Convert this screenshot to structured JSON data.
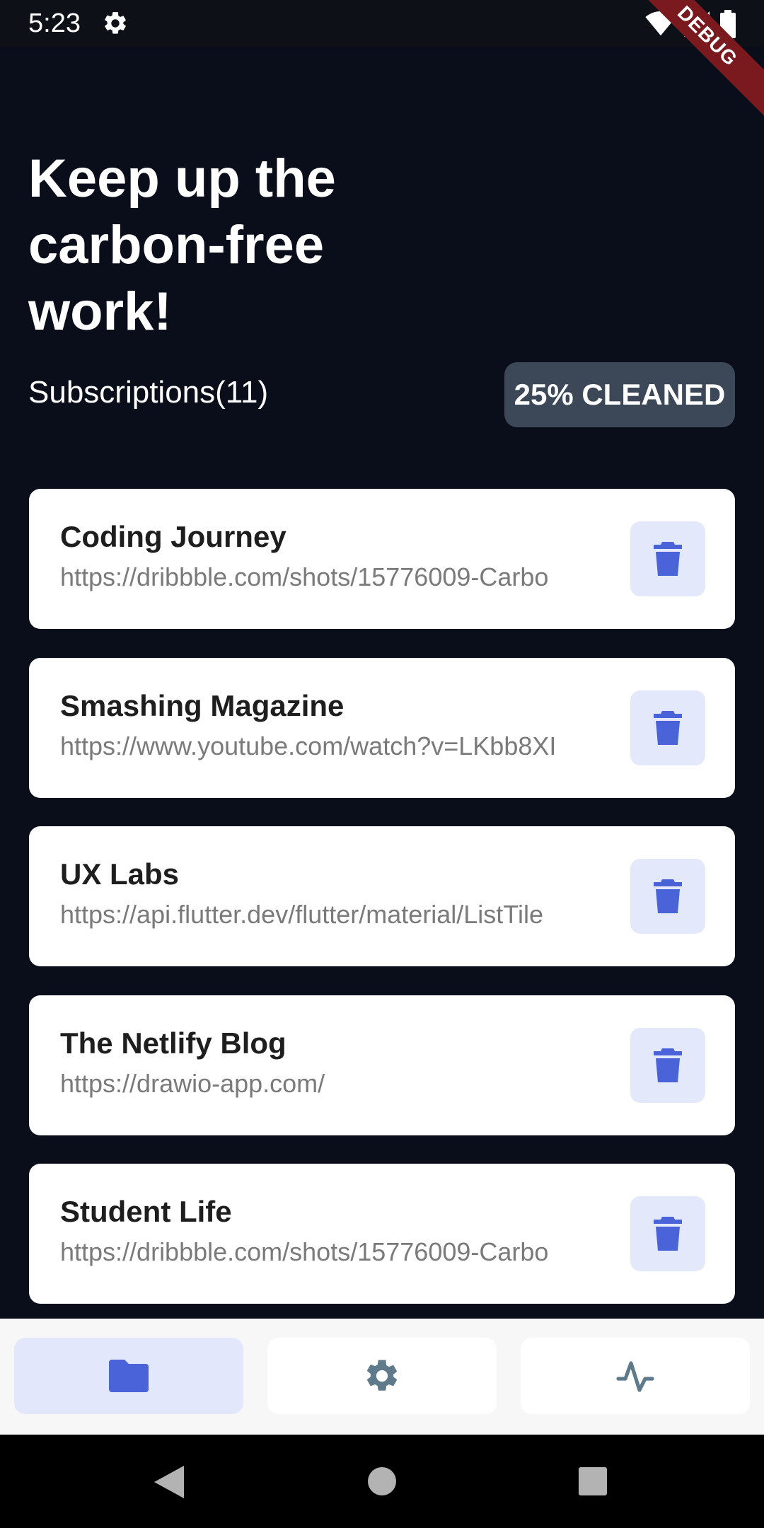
{
  "status_bar": {
    "time": "5:23"
  },
  "debug_banner": "DEBUG",
  "header": {
    "headline": "Keep up the carbon-free work!",
    "subscriptions_label": "Subscriptions(11)",
    "cleaned_badge": "25% CLEANED",
    "cleaned_percent": 25
  },
  "subscriptions": [
    {
      "title": "Coding Journey",
      "url": "https://dribbble.com/shots/15776009-Carbo"
    },
    {
      "title": "Smashing Magazine",
      "url": "https://www.youtube.com/watch?v=LKbb8XI"
    },
    {
      "title": "UX Labs",
      "url": "https://api.flutter.dev/flutter/material/ListTile"
    },
    {
      "title": "The Netlify Blog",
      "url": "https://drawio-app.com/"
    },
    {
      "title": "Student Life",
      "url": "https://dribbble.com/shots/15776009-Carbo"
    }
  ],
  "bottom_nav": {
    "items": [
      {
        "icon": "folder-icon",
        "active": true
      },
      {
        "icon": "settings-icon",
        "active": false
      },
      {
        "icon": "activity-icon",
        "active": false
      }
    ]
  },
  "colors": {
    "background": "#0a0e1a",
    "accent": "#4a63d8",
    "accent_light": "#e3e8fb",
    "badge_bg": "#3c4757",
    "nav_icon_inactive": "#5f7a8a"
  }
}
